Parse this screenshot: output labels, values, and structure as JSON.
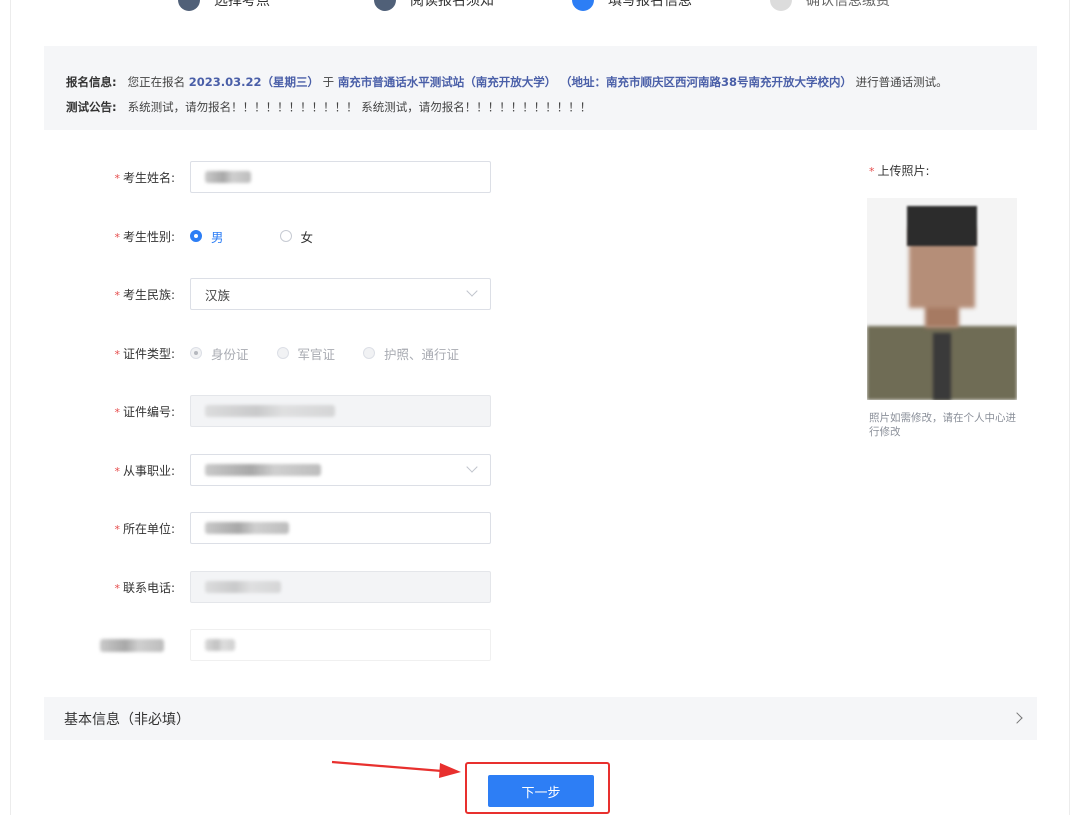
{
  "steps": [
    {
      "label": "选择考点"
    },
    {
      "label": "阅读报名须知"
    },
    {
      "label": "填写报名信息"
    },
    {
      "label": "确认信息缴费"
    }
  ],
  "info": {
    "signup_label": "报名信息:",
    "signup_prefix": "您正在报名",
    "date": "2023.03.22（星期三）",
    "at": "于",
    "site": "南充市普通话水平测试站（南充开放大学）",
    "address": "（地址：南充市顺庆区西河南路38号南充开放大学校内）",
    "suffix": "进行普通话测试。",
    "notice_label": "测试公告:",
    "notice_text": "系统测试，请勿报名！！！！！！！！！！！ 系统测试，请勿报名！！！！！！！！！！！"
  },
  "form": {
    "required_mark": "*",
    "name": {
      "label": "考生姓名:"
    },
    "gender": {
      "label": "考生性别:",
      "options": [
        "男",
        "女"
      ],
      "selected": "男"
    },
    "ethnicity": {
      "label": "考生民族:",
      "value": "汉族"
    },
    "id_type": {
      "label": "证件类型:",
      "options": [
        "身份证",
        "军官证",
        "护照、通行证"
      ],
      "selected": "身份证"
    },
    "id_number": {
      "label": "证件编号:"
    },
    "occupation": {
      "label": "从事职业:"
    },
    "employer": {
      "label": "所在单位:"
    },
    "phone": {
      "label": "联系电话:"
    }
  },
  "photo": {
    "label": "上传照片:",
    "note": "照片如需修改，请在个人中心进行修改"
  },
  "basic": {
    "label": "基本信息（非必填）"
  },
  "next_button": {
    "label": "下一步"
  },
  "colors": {
    "accent": "#2d7ef5",
    "required": "#e64c4c",
    "highlight_frame": "#e8302e"
  }
}
